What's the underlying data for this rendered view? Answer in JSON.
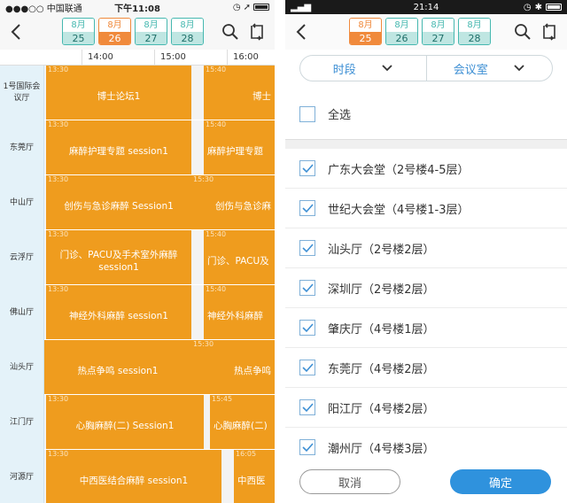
{
  "left": {
    "status": {
      "carrier": "●●●○○ 中国联通",
      "time": "下午11:08"
    },
    "dates": [
      {
        "month": "8月",
        "day": "25",
        "active": false
      },
      {
        "month": "8月",
        "day": "26",
        "active": true
      },
      {
        "month": "8月",
        "day": "27",
        "active": false
      },
      {
        "month": "8月",
        "day": "28",
        "active": false
      }
    ],
    "time_ticks": [
      "14:00",
      "15:00",
      "16:00"
    ],
    "rows": [
      {
        "room": "1号国际会议厅",
        "blocks": [
          {
            "time": "13:30",
            "name": "博士论坛1"
          },
          {
            "time": "15:40",
            "name": "博士"
          }
        ]
      },
      {
        "room": "东莞厅",
        "blocks": [
          {
            "time": "13:30",
            "name": "麻醉护理专题 session1"
          },
          {
            "time": "15:40",
            "name": "麻醉护理专题"
          }
        ]
      },
      {
        "room": "中山厅",
        "blocks": [
          {
            "time": "13:30",
            "name": "创伤与急诊麻醉 Session1"
          },
          {
            "time": "15:30",
            "name": "创伤与急诊麻"
          }
        ]
      },
      {
        "room": "云浮厅",
        "blocks": [
          {
            "time": "13:30",
            "name": "门诊、PACU及手术室外麻醉 session1"
          },
          {
            "time": "15:40",
            "name": "门诊、PACU及"
          }
        ]
      },
      {
        "room": "佛山厅",
        "blocks": [
          {
            "time": "13:30",
            "name": "神经外科麻醉 session1"
          },
          {
            "time": "15:40",
            "name": "神经外科麻醉"
          }
        ]
      },
      {
        "room": "汕头厅",
        "blocks": [
          {
            "time": "",
            "name": "热点争鸣 session1"
          },
          {
            "time": "15:30",
            "name": "热点争鸣"
          }
        ]
      },
      {
        "room": "江门厅",
        "blocks": [
          {
            "time": "13:30",
            "name": "心胸麻醉(二) Session1"
          },
          {
            "time": "15:45",
            "name": "心胸麻醉(二)"
          }
        ]
      },
      {
        "room": "河源厅",
        "blocks": [
          {
            "time": "13:30",
            "name": "中西医结合麻醉 session1"
          },
          {
            "time": "16:05",
            "name": "中西医"
          }
        ]
      }
    ]
  },
  "right": {
    "status": {
      "time": "21:14"
    },
    "dates": [
      {
        "month": "8月",
        "day": "25",
        "active": true
      },
      {
        "month": "8月",
        "day": "26",
        "active": false
      },
      {
        "month": "8月",
        "day": "27",
        "active": false
      },
      {
        "month": "8月",
        "day": "28",
        "active": false
      }
    ],
    "filters": {
      "period": "时段",
      "room": "会议室"
    },
    "select_all": "全选",
    "rooms": [
      {
        "label": "广东大会堂（2号楼4-5层）",
        "checked": true
      },
      {
        "label": "世纪大会堂（4号楼1-3层）",
        "checked": true
      },
      {
        "label": "汕头厅（2号楼2层）",
        "checked": true
      },
      {
        "label": "深圳厅（2号楼2层）",
        "checked": true
      },
      {
        "label": "肇庆厅（4号楼1层）",
        "checked": true
      },
      {
        "label": "东莞厅（4号楼2层）",
        "checked": true
      },
      {
        "label": "阳江厅（4号楼2层）",
        "checked": true
      },
      {
        "label": "潮州厅（4号楼3层）",
        "checked": true
      }
    ],
    "buttons": {
      "cancel": "取消",
      "confirm": "确定"
    }
  },
  "colors": {
    "orange": "#ef9c1e",
    "teal": "#46b8b0",
    "blue": "#2f92dd"
  }
}
